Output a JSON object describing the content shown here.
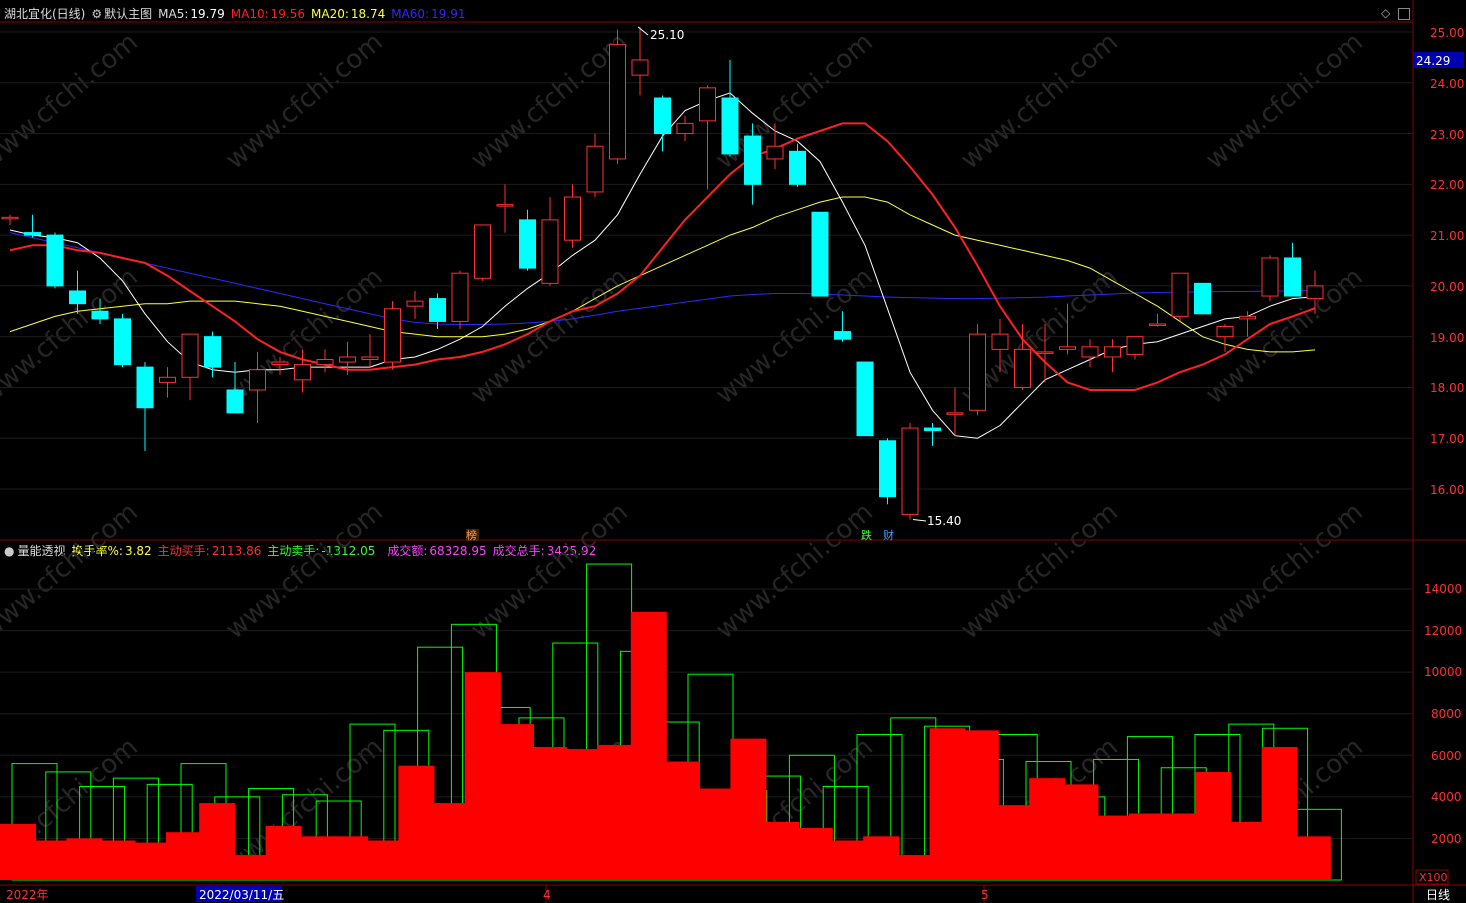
{
  "header": {
    "stock_name": "湖北宜化(日线)",
    "chart_name": "默认主图",
    "ma5_label": "MA5:",
    "ma5_value": "19.79",
    "ma10_label": "MA10:",
    "ma10_value": "19.56",
    "ma20_label": "MA20:",
    "ma20_value": "18.74",
    "ma60_label": "MA60:",
    "ma60_value": "19.91",
    "colors": {
      "ma5": "#ffffff",
      "ma10": "#ff2020",
      "ma20": "#ffff40",
      "ma60": "#2a2aff"
    }
  },
  "sub_header": {
    "indicator_name": "量能透视",
    "turnover_label": "换手率%:",
    "turnover_value": "3.82",
    "buy_label": "主动买手:",
    "buy_value": "2113.86",
    "sell_label": "主动卖手:",
    "sell_value": "-1312.05",
    "amount_label": "成交额:",
    "amount_value": "68328.95",
    "total_label": "成交总手:",
    "total_value": "3425.92"
  },
  "price_axis": {
    "ticks": [
      "25.00",
      "24.00",
      "23.00",
      "22.00",
      "21.00",
      "20.00",
      "19.00",
      "18.00",
      "17.00",
      "16.00"
    ],
    "current_price": "24.29"
  },
  "volume_axis": {
    "ticks": [
      "14000",
      "12000",
      "10000",
      "8000",
      "6000",
      "4000",
      "2000"
    ],
    "unit": "X100"
  },
  "date_axis": {
    "labels": [
      "2022年",
      "2022/03/11/五",
      "4",
      "5"
    ],
    "period": "日线"
  },
  "annotations": {
    "high": "25.10",
    "low": "15.40"
  },
  "markers": [
    "榜",
    "跌",
    "财"
  ],
  "watermark": "www.cfchi.com",
  "chart_data": [
    {
      "type": "candlestick",
      "y_range": [
        15.2,
        25.4
      ],
      "up_color": "#ff3030",
      "down_color": "#00ffff",
      "candles": [
        [
          21.35,
          21.4,
          21.2,
          21.35
        ],
        [
          21.05,
          21.4,
          20.95,
          21.0
        ],
        [
          21.0,
          21.05,
          19.95,
          20.0
        ],
        [
          19.9,
          20.3,
          19.45,
          19.65
        ],
        [
          19.5,
          19.75,
          19.25,
          19.35
        ],
        [
          19.35,
          19.45,
          18.4,
          18.45
        ],
        [
          18.4,
          18.5,
          16.75,
          17.6
        ],
        [
          18.1,
          18.4,
          17.8,
          18.2
        ],
        [
          18.2,
          19.05,
          17.75,
          19.05
        ],
        [
          19.0,
          19.1,
          18.2,
          18.4
        ],
        [
          17.95,
          18.5,
          17.5,
          17.5
        ],
        [
          17.95,
          18.7,
          17.3,
          18.35
        ],
        [
          18.45,
          18.6,
          18.25,
          18.5
        ],
        [
          18.15,
          18.75,
          17.9,
          18.45
        ],
        [
          18.45,
          18.75,
          18.3,
          18.55
        ],
        [
          18.5,
          18.9,
          18.25,
          18.6
        ],
        [
          18.55,
          19.05,
          18.4,
          18.6
        ],
        [
          18.5,
          19.7,
          18.35,
          19.55
        ],
        [
          19.6,
          19.9,
          19.35,
          19.7
        ],
        [
          19.75,
          19.85,
          19.15,
          19.3
        ],
        [
          19.3,
          20.3,
          19.15,
          20.25
        ],
        [
          20.15,
          21.2,
          20.1,
          21.2
        ],
        [
          21.6,
          22.0,
          21.05,
          21.6
        ],
        [
          21.3,
          21.5,
          20.3,
          20.35
        ],
        [
          20.05,
          21.75,
          20.0,
          21.3
        ],
        [
          20.9,
          22.0,
          20.75,
          21.75
        ],
        [
          21.85,
          23.0,
          21.75,
          22.75
        ],
        [
          22.5,
          25.05,
          22.4,
          24.75
        ],
        [
          24.15,
          25.1,
          23.75,
          24.45
        ],
        [
          23.7,
          23.75,
          22.65,
          23.0
        ],
        [
          23.0,
          23.35,
          22.85,
          23.2
        ],
        [
          23.25,
          23.95,
          21.9,
          23.9
        ],
        [
          23.7,
          24.45,
          22.55,
          22.6
        ],
        [
          22.95,
          23.2,
          21.6,
          22.0
        ],
        [
          22.5,
          23.2,
          22.3,
          22.75
        ],
        [
          22.65,
          22.8,
          21.95,
          22.0
        ],
        [
          21.45,
          21.45,
          19.8,
          19.8
        ],
        [
          19.1,
          19.5,
          18.9,
          18.95
        ],
        [
          18.5,
          18.5,
          17.05,
          17.05
        ],
        [
          16.95,
          17.0,
          15.7,
          15.85
        ],
        [
          15.5,
          17.3,
          15.4,
          17.2
        ],
        [
          17.2,
          17.3,
          16.85,
          17.15
        ],
        [
          17.5,
          18.0,
          17.05,
          17.5
        ],
        [
          17.55,
          19.25,
          17.45,
          19.05
        ],
        [
          18.75,
          19.35,
          18.3,
          19.05
        ],
        [
          18.0,
          19.25,
          17.95,
          18.75
        ],
        [
          18.7,
          19.25,
          18.1,
          18.7
        ],
        [
          18.75,
          19.65,
          18.65,
          18.8
        ],
        [
          18.6,
          18.95,
          18.4,
          18.8
        ],
        [
          18.6,
          18.95,
          18.3,
          18.8
        ],
        [
          18.65,
          19.0,
          18.55,
          19.0
        ],
        [
          19.25,
          19.45,
          19.2,
          19.25
        ],
        [
          19.4,
          20.2,
          19.3,
          20.25
        ],
        [
          20.05,
          20.05,
          19.45,
          19.45
        ],
        [
          19.0,
          19.25,
          18.7,
          19.2
        ],
        [
          19.35,
          19.5,
          19.0,
          19.4
        ],
        [
          19.8,
          20.6,
          19.7,
          20.55
        ],
        [
          20.55,
          20.85,
          19.8,
          19.8
        ],
        [
          19.75,
          20.3,
          19.45,
          20.0
        ]
      ],
      "ma5": [
        21.1,
        21.0,
        20.95,
        20.85,
        20.55,
        20.1,
        19.45,
        18.9,
        18.5,
        18.35,
        18.3,
        18.35,
        18.35,
        18.4,
        18.4,
        18.4,
        18.4,
        18.55,
        18.6,
        18.75,
        18.95,
        19.2,
        19.6,
        19.95,
        20.25,
        20.6,
        20.9,
        21.4,
        22.2,
        22.95,
        23.45,
        23.65,
        23.8,
        23.4,
        23.05,
        22.85,
        22.45,
        21.65,
        20.8,
        19.55,
        18.3,
        17.55,
        17.05,
        17.0,
        17.25,
        17.7,
        18.15,
        18.35,
        18.55,
        18.75,
        18.85,
        18.9,
        19.05,
        19.2,
        19.35,
        19.4,
        19.6,
        19.75,
        19.79
      ],
      "ma10": [
        20.7,
        20.8,
        20.8,
        20.7,
        20.65,
        20.55,
        20.45,
        20.2,
        19.9,
        19.6,
        19.3,
        18.95,
        18.7,
        18.55,
        18.45,
        18.35,
        18.35,
        18.4,
        18.45,
        18.55,
        18.6,
        18.7,
        18.85,
        19.05,
        19.3,
        19.5,
        19.6,
        19.85,
        20.2,
        20.75,
        21.3,
        21.75,
        22.2,
        22.55,
        22.7,
        22.9,
        23.05,
        23.2,
        23.2,
        22.85,
        22.35,
        21.8,
        21.15,
        20.4,
        19.6,
        18.95,
        18.5,
        18.1,
        17.95,
        17.95,
        17.95,
        18.1,
        18.3,
        18.45,
        18.65,
        18.95,
        19.25,
        19.4,
        19.56
      ],
      "ma20": [
        19.1,
        19.25,
        19.4,
        19.5,
        19.55,
        19.6,
        19.65,
        19.65,
        19.7,
        19.7,
        19.7,
        19.65,
        19.6,
        19.5,
        19.4,
        19.3,
        19.2,
        19.1,
        19.05,
        19.0,
        19.0,
        19.0,
        19.05,
        19.15,
        19.3,
        19.5,
        19.75,
        20.0,
        20.2,
        20.4,
        20.6,
        20.8,
        21.0,
        21.15,
        21.35,
        21.5,
        21.65,
        21.75,
        21.75,
        21.65,
        21.4,
        21.2,
        21.0,
        20.9,
        20.8,
        20.7,
        20.6,
        20.5,
        20.35,
        20.1,
        19.85,
        19.6,
        19.3,
        19.0,
        18.85,
        18.75,
        18.7,
        18.7,
        18.74
      ],
      "ma60": [
        21.05,
        20.95,
        20.85,
        20.75,
        20.65,
        20.55,
        20.45,
        20.35,
        20.25,
        20.15,
        20.05,
        19.95,
        19.85,
        19.75,
        19.65,
        19.55,
        19.45,
        19.35,
        19.28,
        19.25,
        19.24,
        19.24,
        19.25,
        19.27,
        19.3,
        19.35,
        19.42,
        19.5,
        19.56,
        19.62,
        19.68,
        19.74,
        19.8,
        19.83,
        19.85,
        19.85,
        19.84,
        19.82,
        19.8,
        19.78,
        19.77,
        19.76,
        19.75,
        19.75,
        19.76,
        19.77,
        19.78,
        19.8,
        19.82,
        19.84,
        19.86,
        19.87,
        19.88,
        19.88,
        19.89,
        19.89,
        19.9,
        19.9,
        19.91
      ]
    },
    {
      "type": "bar",
      "y_range": [
        0,
        15000
      ],
      "series": [
        {
          "name": "成交总手",
          "color": "#00ff00",
          "style": "outline",
          "values": [
            5600,
            5200,
            4500,
            4900,
            4600,
            5600,
            4000,
            4400,
            4100,
            3800,
            7500,
            7200,
            11200,
            12300,
            8300,
            7800,
            11400,
            15200,
            11000,
            7600,
            9900,
            4300,
            5000,
            6000,
            4500,
            7000,
            7800,
            7400,
            5800,
            7000,
            5700,
            4000,
            5800,
            6900,
            5400,
            7000,
            7500,
            7300,
            3400
          ]
        },
        {
          "name": "主动买手",
          "color": "#ff0000",
          "style": "fill",
          "values": [
            2700,
            1900,
            2000,
            1900,
            1800,
            2300,
            3700,
            1200,
            2600,
            2100,
            2100,
            1900,
            5500,
            3700,
            10000,
            7500,
            6400,
            6300,
            6500,
            12900,
            5700,
            4400,
            6800,
            2800,
            2500,
            1900,
            2100,
            1200,
            7300,
            7200,
            3600,
            4900,
            4600,
            3100,
            3200,
            3200,
            5200,
            2800,
            6400,
            2100
          ]
        }
      ]
    }
  ]
}
